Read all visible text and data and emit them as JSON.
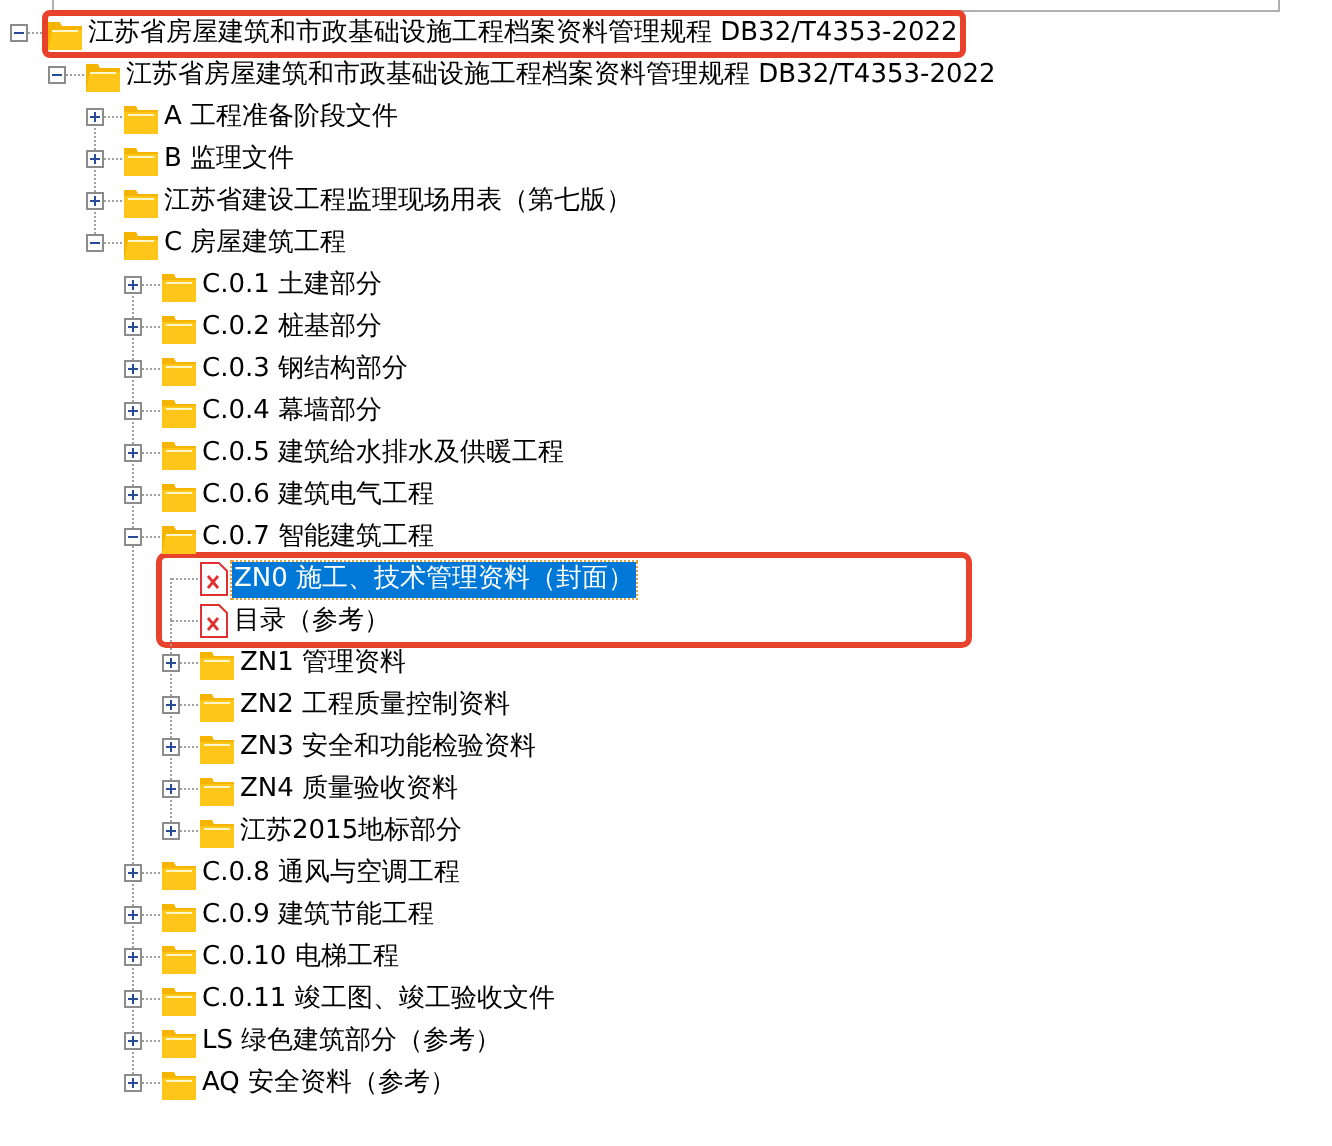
{
  "tree": [
    {
      "label": "江苏省房屋建筑和市政基础设施工程档案资料管理规程 DB32/T4353-2022",
      "kind": "folder",
      "expanded": true,
      "selected": false,
      "highlighted": true,
      "children": [
        {
          "label": "江苏省房屋建筑和市政基础设施工程档案资料管理规程 DB32/T4353-2022",
          "kind": "folder",
          "expanded": true,
          "selected": false,
          "highlighted": false,
          "children": [
            {
              "label": "A 工程准备阶段文件",
              "kind": "folder",
              "expanded": false,
              "selected": false,
              "highlighted": false
            },
            {
              "label": "B 监理文件",
              "kind": "folder",
              "expanded": false,
              "selected": false,
              "highlighted": false
            },
            {
              "label": "江苏省建设工程监理现场用表（第七版）",
              "kind": "folder",
              "expanded": false,
              "selected": false,
              "highlighted": false
            },
            {
              "label": "C 房屋建筑工程",
              "kind": "folder",
              "expanded": true,
              "selected": false,
              "highlighted": false,
              "children": [
                {
                  "label": "C.0.1 土建部分",
                  "kind": "folder",
                  "expanded": false,
                  "selected": false,
                  "highlighted": false
                },
                {
                  "label": "C.0.2 桩基部分",
                  "kind": "folder",
                  "expanded": false,
                  "selected": false,
                  "highlighted": false
                },
                {
                  "label": "C.0.3 钢结构部分",
                  "kind": "folder",
                  "expanded": false,
                  "selected": false,
                  "highlighted": false
                },
                {
                  "label": "C.0.4 幕墙部分",
                  "kind": "folder",
                  "expanded": false,
                  "selected": false,
                  "highlighted": false
                },
                {
                  "label": "C.0.5 建筑给水排水及供暖工程",
                  "kind": "folder",
                  "expanded": false,
                  "selected": false,
                  "highlighted": false
                },
                {
                  "label": "C.0.6 建筑电气工程",
                  "kind": "folder",
                  "expanded": false,
                  "selected": false,
                  "highlighted": false
                },
                {
                  "label": "C.0.7 智能建筑工程",
                  "kind": "folder",
                  "expanded": true,
                  "selected": false,
                  "highlighted": false,
                  "children": [
                    {
                      "label": "ZN0 施工、技术管理资料（封面）",
                      "kind": "file",
                      "selected": true,
                      "highlighted": true
                    },
                    {
                      "label": "目录（参考）",
                      "kind": "file",
                      "selected": false,
                      "highlighted": true
                    },
                    {
                      "label": "ZN1 管理资料",
                      "kind": "folder",
                      "expanded": false,
                      "selected": false,
                      "highlighted": false
                    },
                    {
                      "label": "ZN2 工程质量控制资料",
                      "kind": "folder",
                      "expanded": false,
                      "selected": false,
                      "highlighted": false
                    },
                    {
                      "label": "ZN3 安全和功能检验资料",
                      "kind": "folder",
                      "expanded": false,
                      "selected": false,
                      "highlighted": false
                    },
                    {
                      "label": "ZN4 质量验收资料",
                      "kind": "folder",
                      "expanded": false,
                      "selected": false,
                      "highlighted": false
                    },
                    {
                      "label": "江苏2015地标部分",
                      "kind": "folder",
                      "expanded": false,
                      "selected": false,
                      "highlighted": false
                    }
                  ]
                },
                {
                  "label": "C.0.8 通风与空调工程",
                  "kind": "folder",
                  "expanded": false,
                  "selected": false,
                  "highlighted": false
                },
                {
                  "label": "C.0.9 建筑节能工程",
                  "kind": "folder",
                  "expanded": false,
                  "selected": false,
                  "highlighted": false
                },
                {
                  "label": "C.0.10 电梯工程",
                  "kind": "folder",
                  "expanded": false,
                  "selected": false,
                  "highlighted": false
                },
                {
                  "label": "C.0.11 竣工图、竣工验收文件",
                  "kind": "folder",
                  "expanded": false,
                  "selected": false,
                  "highlighted": false
                },
                {
                  "label": "LS 绿色建筑部分（参考）",
                  "kind": "folder",
                  "expanded": false,
                  "selected": false,
                  "highlighted": false
                },
                {
                  "label": "AQ 安全资料（参考）",
                  "kind": "folder",
                  "expanded": false,
                  "selected": false,
                  "highlighted": false
                }
              ]
            }
          ]
        }
      ]
    }
  ]
}
